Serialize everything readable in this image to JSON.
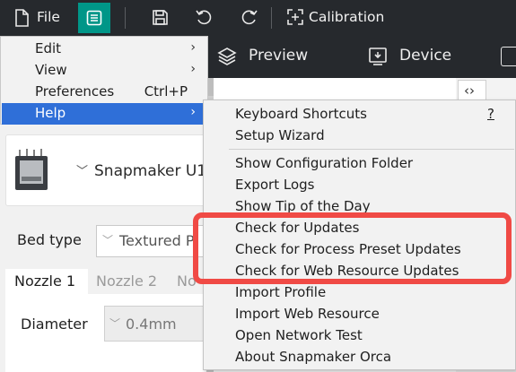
{
  "toolbar": {
    "file_label": "File",
    "calibration_label": "Calibration"
  },
  "tabs": {
    "preview_label": "Preview",
    "device_label": "Device"
  },
  "main_menu": {
    "items": [
      {
        "label": "Edit",
        "shortcut": "",
        "has_submenu": true
      },
      {
        "label": "View",
        "shortcut": "",
        "has_submenu": true
      },
      {
        "label": "Preferences",
        "shortcut": "Ctrl+P",
        "has_submenu": false
      },
      {
        "label": "Help",
        "shortcut": "",
        "has_submenu": true
      }
    ]
  },
  "help_menu": {
    "keyboard_shortcuts": "Keyboard Shortcuts",
    "keyboard_shortcuts_key": "?",
    "setup_wizard": "Setup Wizard",
    "show_config_folder": "Show Configuration Folder",
    "export_logs": "Export Logs",
    "show_tip": "Show Tip of the Day",
    "check_updates": "Check for Updates",
    "check_process_preset_updates": "Check for Process Preset Updates",
    "check_web_resource_updates": "Check for Web Resource Updates",
    "import_profile": "Import Profile",
    "import_web_resource": "Import Web Resource",
    "open_network_test": "Open Network Test",
    "about": "About Snapmaker Orca"
  },
  "left_panel": {
    "printer_name": "Snapmaker U1",
    "bed_type_label": "Bed type",
    "bed_type_value": "Textured P",
    "nozzle_tabs": [
      "Nozzle 1",
      "Nozzle 2",
      "No"
    ],
    "diameter_label": "Diameter",
    "diameter_value": "0.4mm"
  },
  "colors": {
    "toolbar_bg": "#26292d",
    "accent_teal": "#009688",
    "menu_highlight": "#2f6fd8",
    "annotation_red": "#f04a45"
  }
}
